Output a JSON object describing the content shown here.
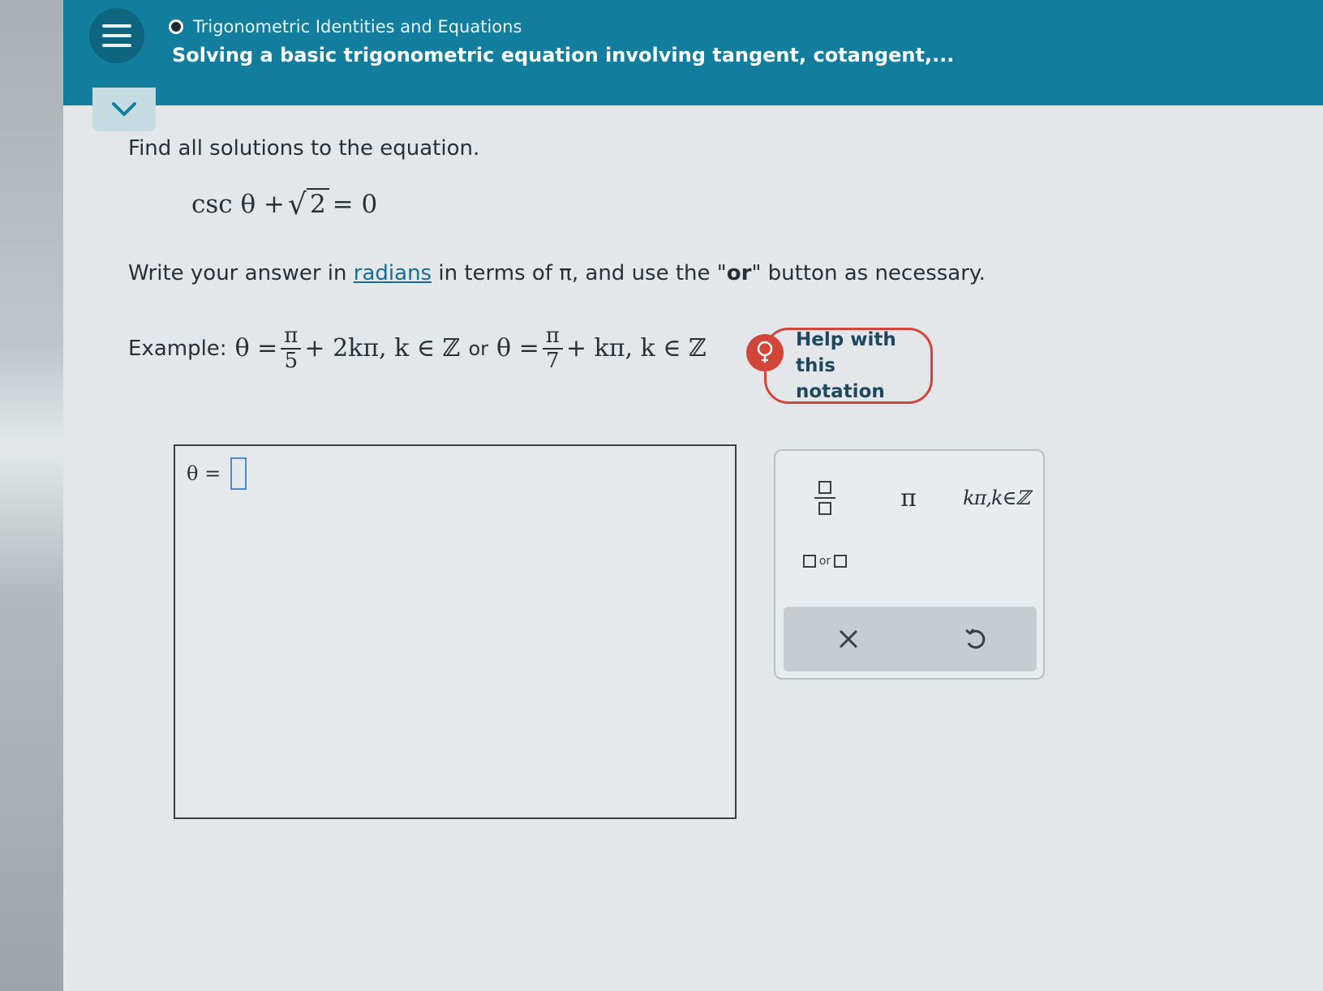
{
  "header": {
    "topic": "Trigonometric Identities and Equations",
    "subtitle": "Solving a basic trigonometric equation involving tangent, cotangent,..."
  },
  "question": {
    "prompt": "Find all solutions to the equation.",
    "equation": {
      "lhs": "csc θ +",
      "radicand": "2",
      "rhs": "= 0"
    },
    "instructions": {
      "before_link": "Write your answer in ",
      "link": "radians",
      "middle": " in terms of π, and use the \"",
      "bold": "or",
      "after": "\" button as necessary."
    },
    "example": {
      "label": "Example:",
      "part1_prefix": "θ =",
      "frac1_num": "π",
      "frac1_den": "5",
      "part1_suffix": "+ 2kπ, k ∈ ℤ",
      "or_word": "or",
      "part2_prefix": "θ =",
      "frac2_num": "π",
      "frac2_den": "7",
      "part2_suffix": "+ kπ, k ∈ ℤ"
    }
  },
  "help": {
    "line1": "Help with",
    "line2": "this notation",
    "icon": "lightbulb-icon"
  },
  "answer": {
    "variable": "θ =",
    "value": ""
  },
  "keypad": {
    "fraction_key": "fraction-icon",
    "pi_key": "π",
    "kpi_key": "kπ,k∈ℤ",
    "or_key": "or",
    "clear_key": "×",
    "undo_key": "undo-icon"
  },
  "colors": {
    "header": "#127d9c",
    "help_accent": "#d2463a",
    "link": "#1a6c93"
  }
}
